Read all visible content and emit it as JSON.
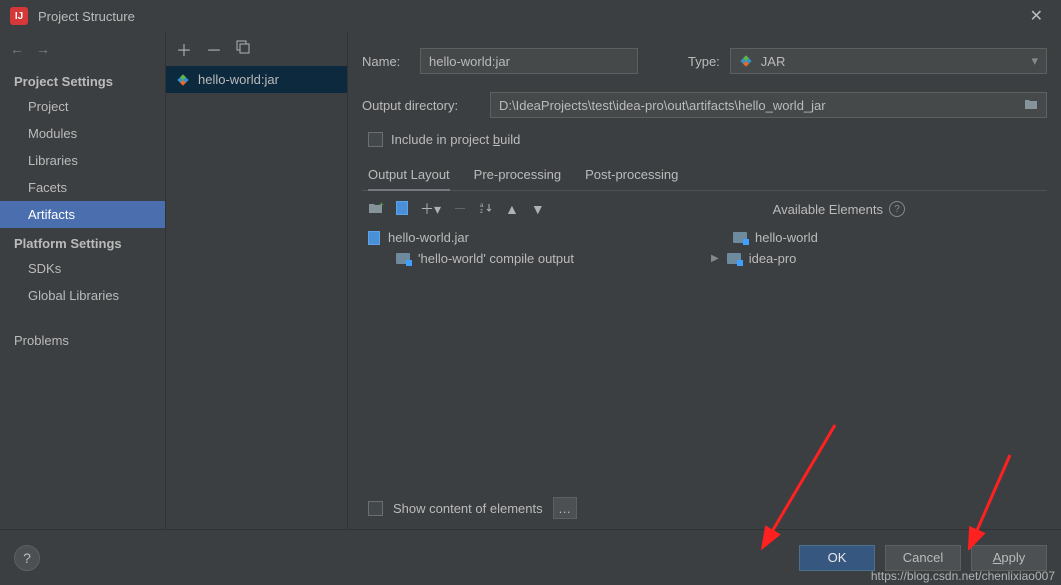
{
  "dialog": {
    "title": "Project Structure"
  },
  "sidebar": {
    "headers": {
      "project": "Project Settings",
      "platform": "Platform Settings"
    },
    "items": {
      "project": "Project",
      "modules": "Modules",
      "libraries": "Libraries",
      "facets": "Facets",
      "artifacts": "Artifacts",
      "sdks": "SDKs",
      "globalLibraries": "Global Libraries",
      "problems": "Problems"
    }
  },
  "artifactList": {
    "selected": "hello-world:jar"
  },
  "main": {
    "nameLabel": "Name:",
    "nameValue": "hello-world:jar",
    "typeLabel": "Type:",
    "typeValue": "JAR",
    "outDirLabel": "Output directory:",
    "outDirValue": "D:\\IdeaProjects\\test\\idea-pro\\out\\artifacts\\hello_world_jar",
    "includeBuild_pre": "Include in project ",
    "includeBuild_u": "b",
    "includeBuild_post": "uild",
    "tabs": {
      "layout": "Output Layout",
      "pre": "Pre-processing",
      "post": "Post-processing"
    },
    "tree": {
      "jar": "hello-world.jar",
      "compile": "'hello-world' compile output"
    },
    "available": {
      "title": "Available Elements",
      "items": {
        "hw": "hello-world",
        "ip": "idea-pro"
      }
    },
    "showContent": "Show content of elements"
  },
  "footer": {
    "ok": "OK",
    "cancel": "Cancel",
    "apply_u": "A",
    "apply_post": "pply"
  },
  "watermark": "https://blog.csdn.net/chenlixiao007"
}
